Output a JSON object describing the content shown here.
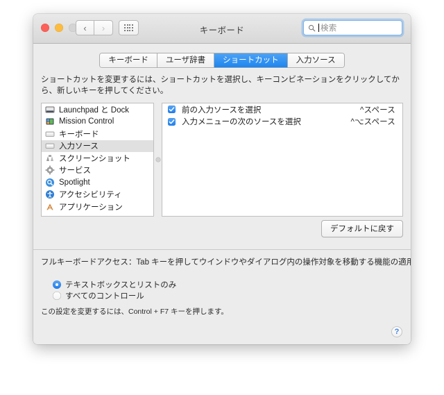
{
  "window": {
    "title": "キーボード",
    "traffic_lights": [
      {
        "name": "close",
        "color": "#fc6058"
      },
      {
        "name": "minimize",
        "color": "#fdbc40"
      },
      {
        "name": "zoom",
        "color": "#d4d4d4"
      }
    ],
    "nav": {
      "back_icon": "chevron-left-icon",
      "forward_icon": "chevron-right-icon",
      "grid_icon": "show-all-grid-icon"
    },
    "search": {
      "placeholder": "検索",
      "value": "",
      "icon": "search-icon"
    }
  },
  "tabs": [
    {
      "label": "キーボード",
      "active": false
    },
    {
      "label": "ユーザ辞書",
      "active": false
    },
    {
      "label": "ショートカット",
      "active": true
    },
    {
      "label": "入力ソース",
      "active": false
    }
  ],
  "instruction": "ショートカットを変更するには、ショートカットを選択し、キーコンビネーションをクリックしてから、新しいキーを押してください。",
  "categories": [
    {
      "label": "Launchpad と Dock",
      "icon": "dock-icon",
      "selected": false
    },
    {
      "label": "Mission Control",
      "icon": "mission-control-icon",
      "selected": false
    },
    {
      "label": "キーボード",
      "icon": "keyboard-icon",
      "selected": false
    },
    {
      "label": "入力ソース",
      "icon": "input-sources-icon",
      "selected": true
    },
    {
      "label": "スクリーンショット",
      "icon": "screenshot-icon",
      "selected": false
    },
    {
      "label": "サービス",
      "icon": "services-gear-icon",
      "selected": false
    },
    {
      "label": "Spotlight",
      "icon": "spotlight-icon",
      "selected": false
    },
    {
      "label": "アクセシビリティ",
      "icon": "accessibility-icon",
      "selected": false
    },
    {
      "label": "アプリケーション",
      "icon": "application-icon",
      "selected": false
    }
  ],
  "shortcuts": [
    {
      "checked": true,
      "name": "前の入力ソースを選択",
      "key": "^スペース"
    },
    {
      "checked": true,
      "name": "入力メニューの次のソースを選択",
      "key": "^⌥スペース"
    }
  ],
  "buttons": {
    "restore_defaults": "デフォルトに戻す",
    "help": "?"
  },
  "full_keyboard_access": {
    "label": "フルキーボードアクセス：Tab キーを押してウインドウやダイアログ内の操作対象を移動する機能の適用範囲：",
    "options": [
      {
        "label": "テキストボックスとリストのみ",
        "selected": true
      },
      {
        "label": "すべてのコントロール",
        "selected": false
      }
    ],
    "note": "この設定を変更するには、Control + F7 キーを押します。"
  },
  "colors": {
    "accent": "#1d85ef",
    "window_bg": "#ececec",
    "selection": "#e0e0e0"
  }
}
